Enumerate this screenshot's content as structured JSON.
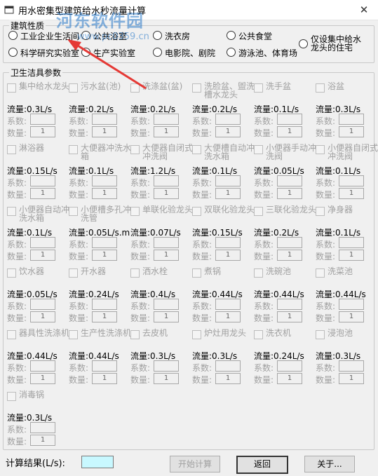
{
  "window": {
    "title": "用水密集型建筑给水秒流量计算",
    "close_glyph": "✕",
    "watermark": "河东软件园",
    "watermark_url": "www.pc0359.cn"
  },
  "building": {
    "group_title": "建筑性质",
    "options": [
      "工业企业生活间",
      "公共浴室",
      "洗衣房",
      "公共食堂",
      "科学研究实验室",
      "生产实验室",
      "电影院、剧院",
      "游泳池、体育场",
      "仅设集中给水龙头的住宅"
    ]
  },
  "fixtures_group": {
    "title": "卫生洁具参数"
  },
  "labels": {
    "coef": "系数:",
    "count": "数量:"
  },
  "fixtures": [
    {
      "name": "集中给水龙头",
      "flow": "流量:0.3L/s",
      "count": "1"
    },
    {
      "name": "污水盆(池)",
      "flow": "流量:0.2L/s",
      "count": "1"
    },
    {
      "name": "洗涤盆(盆)",
      "flow": "流量:0.2L/s",
      "count": "1"
    },
    {
      "name": "洗脸盆、盥洗槽水龙头",
      "flow": "流量:0.2L/s",
      "count": "1"
    },
    {
      "name": "洗手盆",
      "flow": "流量:0.1L/s",
      "count": "1"
    },
    {
      "name": "浴盆",
      "flow": "流量:0.3L/s",
      "count": "1"
    },
    {
      "name": "淋浴器",
      "flow": "流量:0.15L/s",
      "count": "1"
    },
    {
      "name": "大便器冲洗水箱",
      "flow": "流量:0.1L/s",
      "count": "1"
    },
    {
      "name": "大便器自闭式冲洗阀",
      "flow": "流量:1.2L/s",
      "count": "1"
    },
    {
      "name": "大便槽自动冲洗水箱",
      "flow": "流量:0.1L/s",
      "count": "1"
    },
    {
      "name": "小便器手动冲洗阀",
      "flow": "流量:0.05L/s",
      "count": "1"
    },
    {
      "name": "小便器自闭式冲洗阀",
      "flow": "流量:0.1L/s",
      "count": "1"
    },
    {
      "name": "小便器自动冲洗水箱",
      "flow": "流量:0.1L/s",
      "count": "1"
    },
    {
      "name": "小便槽多孔冲洗管",
      "flow": "流量:0.05L/s.m",
      "count": "1"
    },
    {
      "name": "单联化验龙头",
      "flow": "流量:0.07L/s",
      "count": "1"
    },
    {
      "name": "双联化验龙头",
      "flow": "流量:0.15L/s",
      "count": "1"
    },
    {
      "name": "三联化验龙头",
      "flow": "流量:0.2L/s",
      "count": "1"
    },
    {
      "name": "净身器",
      "flow": "流量:0.1L/s",
      "count": "1"
    },
    {
      "name": "饮水器",
      "flow": "流量:0.05L/s",
      "count": "1"
    },
    {
      "name": "开水器",
      "flow": "流量:0.24L/s",
      "count": "1"
    },
    {
      "name": "洒水栓",
      "flow": "流量:0.4L/s",
      "count": "1"
    },
    {
      "name": "煮锅",
      "flow": "流量:0.44L/s",
      "count": "1"
    },
    {
      "name": "洗碗池",
      "flow": "流量:0.44L/s",
      "count": "1"
    },
    {
      "name": "洗菜池",
      "flow": "流量:0.44L/s",
      "count": "1"
    },
    {
      "name": "器具性洗涤机",
      "flow": "流量:0.44L/s",
      "count": "1"
    },
    {
      "name": "生产性洗涤机",
      "flow": "流量:0.44L/s",
      "count": "1"
    },
    {
      "name": "去皮机",
      "flow": "流量:0.3L/s",
      "count": "1"
    },
    {
      "name": "炉灶用龙头",
      "flow": "流量:0.3L/s",
      "count": "1"
    },
    {
      "name": "洗衣机",
      "flow": "流量:0.24L/s",
      "count": "1"
    },
    {
      "name": "浸泡池",
      "flow": "流量:0.3L/s",
      "count": "1"
    },
    {
      "name": "消毒锅",
      "flow": "流量:0.3L/s",
      "count": "1"
    }
  ],
  "result": {
    "label": "计算结果(L/s):",
    "value": ""
  },
  "buttons": {
    "start": "开始计算",
    "back": "返回",
    "about": "关于..."
  },
  "colors": {
    "result_bg": "#c8f8ff",
    "arrow": "#e53935",
    "watermark": "#2878c8"
  }
}
